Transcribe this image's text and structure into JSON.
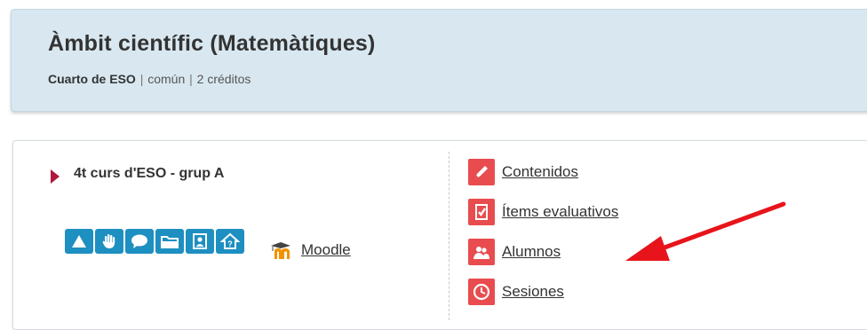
{
  "course": {
    "title": "Àmbit científic (Matemàtiques)",
    "level": "Cuarto de ESO",
    "type": "común",
    "credits": "2 créditos",
    "separator": "|"
  },
  "group": {
    "name": "4t curs d'ESO - grup A",
    "tools": [
      "triangle-icon",
      "hand-icon",
      "chat-bubble-icon",
      "folder-icon",
      "profile-card-icon",
      "home-question-icon"
    ],
    "moodle_label": "Moodle"
  },
  "menu": {
    "items": [
      {
        "label": "Contenidos",
        "icon": "pencil-icon"
      },
      {
        "label": "Ítems evaluativos",
        "icon": "checklist-icon"
      },
      {
        "label": "Alumnos",
        "icon": "students-icon"
      },
      {
        "label": "Sesiones",
        "icon": "clock-icon"
      }
    ]
  },
  "colors": {
    "menu_icon": "#e84c4f",
    "tool_icon": "#1d8fc1",
    "annotation_arrow": "#e8141b",
    "group_marker": "#b0173f"
  }
}
